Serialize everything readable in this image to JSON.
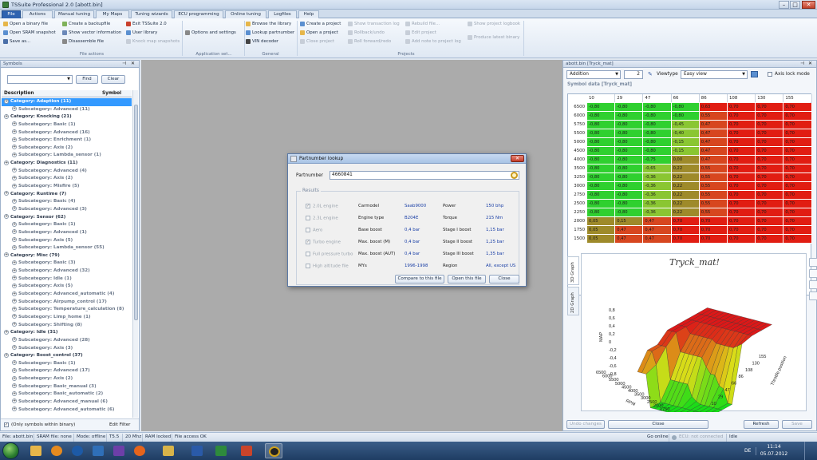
{
  "window": {
    "title": "TSSuite Professional 2.0 [abott.bin]",
    "minimize": "–",
    "maximize": "□",
    "close": "✕"
  },
  "tabs": [
    "File",
    "Actions",
    "Manual tuning",
    "My Maps",
    "Tuning wizards",
    "ECU programming",
    "Online tuning",
    "Logfiles",
    "Help"
  ],
  "ribbon": {
    "file_actions": {
      "label": "File actions",
      "items": [
        "Open a binary file",
        "Open SRAM snapshot",
        "Save as...",
        "Create a backupfile",
        "Show vector information",
        "Disassemble file",
        "Exit TSSuite 2.0",
        "User library",
        "Knock map snapshots"
      ]
    },
    "application_settings": {
      "label": "Application set...",
      "items": [
        "Options and settings"
      ]
    },
    "general": {
      "label": "General",
      "items": [
        "Browse the library",
        "Lookup partnumber",
        "VIN decoder"
      ]
    },
    "projects": {
      "label": "Projects",
      "items": [
        "Create a project",
        "Open a project",
        "Close project",
        "Show transaction log",
        "Rollback/undo",
        "Roll forward/redo",
        "Rebuild file...",
        "Edit project",
        "Add note to project log",
        "Show project logbook",
        "Produce latest binary"
      ]
    }
  },
  "symbols_panel": {
    "title": "Symbols",
    "find": "Find",
    "clear": "Clear",
    "col_description": "Description",
    "col_symbol": "Symbol",
    "items": [
      {
        "t": "Category: Adaption (11)",
        "k": "cat",
        "sel": true
      },
      {
        "t": "Subcategory: Advanced (11)",
        "k": "sub"
      },
      {
        "t": "Category: Knocking (21)",
        "k": "cat"
      },
      {
        "t": "Subcategory: Basic (1)",
        "k": "sub"
      },
      {
        "t": "Subcategory: Advanced (16)",
        "k": "sub"
      },
      {
        "t": "Subcategory: Enrichment (1)",
        "k": "sub"
      },
      {
        "t": "Subcategory: Axis (2)",
        "k": "sub"
      },
      {
        "t": "Subcategory: Lambda_sensor (1)",
        "k": "sub"
      },
      {
        "t": "Category: Diagnostics (11)",
        "k": "cat"
      },
      {
        "t": "Subcategory: Advanced (4)",
        "k": "sub"
      },
      {
        "t": "Subcategory: Axis (2)",
        "k": "sub"
      },
      {
        "t": "Subcategory: Misfire (5)",
        "k": "sub"
      },
      {
        "t": "Category: Runtime (7)",
        "k": "cat"
      },
      {
        "t": "Subcategory: Basic (4)",
        "k": "sub"
      },
      {
        "t": "Subcategory: Advanced (3)",
        "k": "sub"
      },
      {
        "t": "Category: Sensor (62)",
        "k": "cat"
      },
      {
        "t": "Subcategory: Basic (1)",
        "k": "sub"
      },
      {
        "t": "Subcategory: Advanced (1)",
        "k": "sub"
      },
      {
        "t": "Subcategory: Axis (5)",
        "k": "sub"
      },
      {
        "t": "Subcategory: Lambda_sensor (55)",
        "k": "sub"
      },
      {
        "t": "Category: Misc (79)",
        "k": "cat"
      },
      {
        "t": "Subcategory: Basic (3)",
        "k": "sub"
      },
      {
        "t": "Subcategory: Advanced (32)",
        "k": "sub"
      },
      {
        "t": "Subcategory: Idle (1)",
        "k": "sub"
      },
      {
        "t": "Subcategory: Axis (5)",
        "k": "sub"
      },
      {
        "t": "Subcategory: Advanced_automatic (4)",
        "k": "sub"
      },
      {
        "t": "Subcategory: Airpump_control (17)",
        "k": "sub"
      },
      {
        "t": "Subcategory: Temperature_calculation (8)",
        "k": "sub"
      },
      {
        "t": "Subcategory: Limp_home (1)",
        "k": "sub"
      },
      {
        "t": "Subcategory: Shifting (8)",
        "k": "sub"
      },
      {
        "t": "Category: Idle (31)",
        "k": "cat"
      },
      {
        "t": "Subcategory: Advanced (28)",
        "k": "sub"
      },
      {
        "t": "Subcategory: Axis (3)",
        "k": "sub"
      },
      {
        "t": "Category: Boost_control (37)",
        "k": "cat"
      },
      {
        "t": "Subcategory: Basic (1)",
        "k": "sub"
      },
      {
        "t": "Subcategory: Advanced (17)",
        "k": "sub"
      },
      {
        "t": "Subcategory: Axis (2)",
        "k": "sub"
      },
      {
        "t": "Subcategory: Basic_manual (3)",
        "k": "sub"
      },
      {
        "t": "Subcategory: Basic_automatic (2)",
        "k": "sub"
      },
      {
        "t": "Subcategory: Advanced_manual (6)",
        "k": "sub"
      },
      {
        "t": "Subcategory: Advanced_automatic (6)",
        "k": "sub"
      }
    ],
    "only_symbols_label": "(Only symbols within binary)",
    "edit_filter": "Edit Filter"
  },
  "dialog": {
    "title": "Partnumber lookup",
    "partnumber_label": "Partnumber",
    "partnumber_value": "4660841",
    "results_label": "Results",
    "checks": [
      {
        "label": "2.0L engine",
        "checked": true
      },
      {
        "label": "2.3L engine",
        "checked": false
      },
      {
        "label": "Aero",
        "checked": false
      },
      {
        "label": "Turbo engine",
        "checked": true
      },
      {
        "label": "Full pressure turbo",
        "checked": false
      },
      {
        "label": "High altitude file",
        "checked": false
      }
    ],
    "fields1": [
      {
        "label": "Carmodel",
        "value": "Saab9000"
      },
      {
        "label": "Engine type",
        "value": "B204E"
      },
      {
        "label": "Base boost",
        "value": "0,4 bar"
      },
      {
        "label": "Max. boost (M)",
        "value": "0,4 bar"
      },
      {
        "label": "Max. boost (AUT)",
        "value": "0,4 bar"
      },
      {
        "label": "MYs",
        "value": "1996-1998"
      }
    ],
    "fields2": [
      {
        "label": "Power",
        "value": "150 bhp"
      },
      {
        "label": "Torque",
        "value": "215 Nm"
      },
      {
        "label": "Stage I boost",
        "value": "1,15 bar"
      },
      {
        "label": "Stage II boost",
        "value": "1,25 bar"
      },
      {
        "label": "Stage III boost",
        "value": "1,35 bar"
      },
      {
        "label": "Region",
        "value": "All, except US"
      }
    ],
    "btn_compare": "Compare to this file",
    "btn_open": "Open this file",
    "btn_close": "Close"
  },
  "right_panel": {
    "title": "abott.bin [Tryck_mat]",
    "operation": "Addition",
    "operand": "2",
    "viewtype_label": "Viewtype",
    "viewtype_value": "Easy view",
    "axis_lock": "Axis lock mode",
    "symbol_header": "Symbol data [Tryck_mat]",
    "col_headers": [
      "10",
      "29",
      "47",
      "66",
      "86",
      "108",
      "130",
      "155"
    ],
    "row_headers": [
      "6500",
      "6000",
      "5750",
      "5500",
      "5000",
      "4500",
      "4000",
      "3500",
      "3250",
      "3000",
      "2750",
      "2500",
      "2250",
      "2000",
      "1750",
      "1500"
    ],
    "cells": [
      [
        "-0,80",
        "-0,80",
        "-0,80",
        "-0,80",
        "0,63",
        "0,70",
        "0,70",
        "0,70"
      ],
      [
        "-0,80",
        "-0,80",
        "-0,80",
        "-0,80",
        "0,55",
        "0,70",
        "0,70",
        "0,70"
      ],
      [
        "-0,80",
        "-0,80",
        "-0,80",
        "-0,45",
        "0,47",
        "0,70",
        "0,70",
        "0,70"
      ],
      [
        "-0,80",
        "-0,80",
        "-0,80",
        "-0,40",
        "0,47",
        "0,70",
        "0,70",
        "0,70"
      ],
      [
        "-0,80",
        "-0,80",
        "-0,80",
        "-0,15",
        "0,47",
        "0,70",
        "0,70",
        "0,70"
      ],
      [
        "-0,80",
        "-0,80",
        "-0,80",
        "-0,15",
        "0,47",
        "0,70",
        "0,70",
        "0,70"
      ],
      [
        "-0,80",
        "-0,80",
        "-0,75",
        "0,00",
        "0,47",
        "0,70",
        "0,70",
        "0,70"
      ],
      [
        "-0,80",
        "-0,80",
        "-0,65",
        "0,22",
        "0,55",
        "0,70",
        "0,70",
        "0,70"
      ],
      [
        "-0,80",
        "-0,80",
        "-0,36",
        "0,22",
        "0,55",
        "0,70",
        "0,70",
        "0,70"
      ],
      [
        "-0,80",
        "-0,80",
        "-0,36",
        "0,22",
        "0,55",
        "0,70",
        "0,70",
        "0,70"
      ],
      [
        "-0,80",
        "-0,80",
        "-0,36",
        "0,22",
        "0,55",
        "0,70",
        "0,70",
        "0,70"
      ],
      [
        "-0,80",
        "-0,80",
        "-0,36",
        "0,22",
        "0,55",
        "0,70",
        "0,70",
        "0,70"
      ],
      [
        "-0,80",
        "-0,80",
        "-0,36",
        "0,22",
        "0,55",
        "0,70",
        "0,70",
        "0,70"
      ],
      [
        "0,05",
        "0,15",
        "0,47",
        "0,70",
        "0,70",
        "0,70",
        "0,70",
        "0,70"
      ],
      [
        "0,05",
        "0,47",
        "0,47",
        "0,70",
        "0,70",
        "0,70",
        "0,70",
        "0,70"
      ],
      [
        "0,05",
        "0,47",
        "0,47",
        "0,70",
        "0,70",
        "0,70",
        "0,70",
        "0,70"
      ]
    ],
    "graph_title": "Tryck_mat!",
    "tab_3d": "3D Graph",
    "tab_2d": "2D Graph",
    "axis_map": "MAP",
    "axis_rpm": "RPM",
    "axis_throttle": "Throttle position",
    "z_ticks": [
      "0,8",
      "0,6",
      "0,4",
      "0,2",
      "0",
      "-0,2",
      "-0,4",
      "-0,6",
      "-0,8"
    ],
    "rpm_ticks": [
      "6500",
      "6000",
      "5500",
      "5000",
      "4500",
      "4000",
      "3500",
      "3000",
      "2500",
      "2000",
      "1750"
    ],
    "thr_ticks": [
      "155",
      "130",
      "108",
      "86",
      "66",
      "47",
      "29",
      "10"
    ],
    "btn_undo": "Undo changes",
    "btn_close": "Close",
    "btn_refresh": "Refresh",
    "btn_save": "Save"
  },
  "statusbar": {
    "file": "File: abott.bin",
    "sram": "SRAM file: none",
    "mode": "Mode: offline",
    "ver": "T5.5",
    "mhz": "20 Mhz",
    "ram": "RAM locked",
    "access": "File access OK",
    "go_online": "Go online",
    "ecu": "ECU: not connected",
    "idle": "Idle"
  },
  "taskbar": {
    "lang": "DE",
    "time": "11:14",
    "date": "05.07.2012"
  },
  "colors": {
    "green": "#2fd02f",
    "yellow_green": "#8ac632",
    "olive": "#9e8a2a",
    "orange_red": "#d7461f",
    "red": "#e11d12",
    "selected": "#3399ff"
  }
}
